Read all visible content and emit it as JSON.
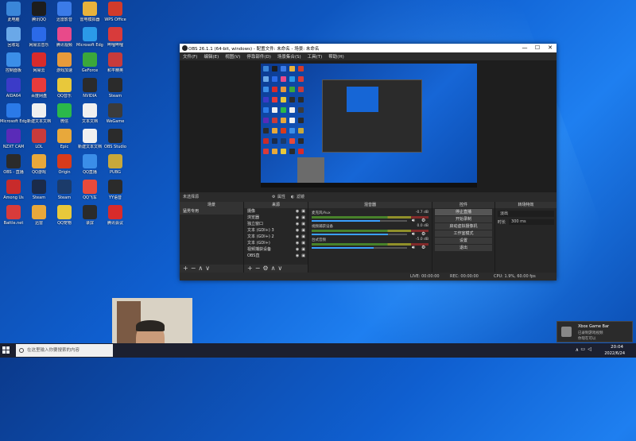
{
  "desktop": {
    "icons": [
      {
        "label": "此电脑",
        "color": "#3a86d9"
      },
      {
        "label": "腾讯QQ",
        "color": "#1d1d1d"
      },
      {
        "label": "迅雷影音",
        "color": "#3b7be8"
      },
      {
        "label": "雷电模拟器",
        "color": "#e8b23b"
      },
      {
        "label": "WPS Office",
        "color": "#d23b2b"
      },
      {
        "label": "回收站",
        "color": "#6aa8e8"
      },
      {
        "label": "网易云音乐",
        "color": "#2b6ae8"
      },
      {
        "label": "腾讯视频",
        "color": "#e84a8a"
      },
      {
        "label": "Microsoft Edge",
        "color": "#2b9ae8"
      },
      {
        "label": "哔哩哔哩",
        "color": "#d83b3b"
      },
      {
        "label": "控制面板",
        "color": "#3b8ee8"
      },
      {
        "label": "网易云",
        "color": "#d82b2b"
      },
      {
        "label": "游戏加速",
        "color": "#e89a3b"
      },
      {
        "label": "GeForce",
        "color": "#3ba83b"
      },
      {
        "label": "和平精英",
        "color": "#c83b3b"
      },
      {
        "label": "AIDA64",
        "color": "#3b3bc8"
      },
      {
        "label": "百度网盘",
        "color": "#e83b3b"
      },
      {
        "label": "QQ音乐",
        "color": "#e8c83b"
      },
      {
        "label": "NVIDIA",
        "color": "#2b2b2b"
      },
      {
        "label": "Steam",
        "color": "#2b2b2b"
      },
      {
        "label": "Microsoft Edge",
        "color": "#2b7ae8"
      },
      {
        "label": "新建文本文档",
        "color": "#f0f0f0"
      },
      {
        "label": "微信",
        "color": "#2bb84a"
      },
      {
        "label": "文本文档",
        "color": "#f0f0f0"
      },
      {
        "label": "WeGame",
        "color": "#3b3b3b"
      },
      {
        "label": "NZXT CAM",
        "color": "#5a2bb8"
      },
      {
        "label": "LOL",
        "color": "#c83b3b"
      },
      {
        "label": "Epic",
        "color": "#e8a83b"
      },
      {
        "label": "新建文本文档",
        "color": "#f0f0f0"
      },
      {
        "label": "OBS Studio",
        "color": "#2b2b2b"
      },
      {
        "label": "OBS - 直播",
        "color": "#2b2b2b"
      },
      {
        "label": "QQ游戏",
        "color": "#e8a83b"
      },
      {
        "label": "Origin",
        "color": "#d83b1b"
      },
      {
        "label": "QQ直播",
        "color": "#3b8ee8"
      },
      {
        "label": "PUBG",
        "color": "#c8a83b"
      },
      {
        "label": "Among Us",
        "color": "#c82b2b"
      },
      {
        "label": "Steam",
        "color": "#1b2b4a"
      },
      {
        "label": "Steam",
        "color": "#1b3b6a"
      },
      {
        "label": "QQ飞车",
        "color": "#e84a3b"
      },
      {
        "label": "YY语音",
        "color": "#2b2b2b"
      },
      {
        "label": "Battle.net",
        "color": "#d83b3b"
      },
      {
        "label": "迅雷",
        "color": "#e8a83b"
      },
      {
        "label": "QQ宠物",
        "color": "#e8c83b"
      },
      {
        "label": "录屏",
        "color": "#2b2b2b"
      },
      {
        "label": "腾讯会议",
        "color": "#d82b2b"
      }
    ]
  },
  "obs": {
    "title": "OBS 26.1.1 (64-bit, windows) - 配置文件: 未命名 - 场景: 未命名",
    "menu": [
      "文件(F)",
      "编辑(E)",
      "视图(V)",
      "停靠部件(D)",
      "场景集合(S)",
      "工具(T)",
      "帮助(H)"
    ],
    "win_min": "—",
    "win_max": "☐",
    "win_close": "✕",
    "no_source": "未选择源",
    "props_btn": "属性",
    "filters_btn": "滤镜",
    "panels": {
      "scenes": "场景",
      "sources": "来源",
      "mixer": "混音器",
      "controls": "控件",
      "transitions": "转场特效"
    },
    "scene_item": "猛男专用",
    "sources": [
      "摄像",
      "浏览器",
      "独立窗口",
      "文本 (GDI+) 3",
      "文本 (GDI+) 2",
      "文本 (GDI+)",
      "视频捕获设备",
      "OBS直"
    ],
    "mixer": [
      {
        "name": "麦克风/Aux",
        "db": "-0.7 dB",
        "level": 0.72
      },
      {
        "name": "视频捕获设备",
        "db": "0.0 dB",
        "level": 0.8
      },
      {
        "name": "台式音频",
        "db": "-5.0 dB",
        "level": 0.65
      }
    ],
    "controls": [
      "停止直播",
      "开始录制",
      "启动虚拟摄像机",
      "工作室模式",
      "设置",
      "退出"
    ],
    "transition_value": "淡出",
    "duration_label": "时长",
    "duration_value": "300 ms",
    "status": {
      "live": "LIVE: 00:00:00",
      "rec": "REC: 00:00:00",
      "cpu": "CPU: 1.9%, 60.00 fps"
    }
  },
  "notification": {
    "app": "Xbox Game Bar",
    "line1": "已录制游戏视频",
    "line2": "你现在可以"
  },
  "taskbar": {
    "search_placeholder": "在这里输入你要搜索的内容",
    "time": "20:04",
    "date": "2022/6/24"
  }
}
